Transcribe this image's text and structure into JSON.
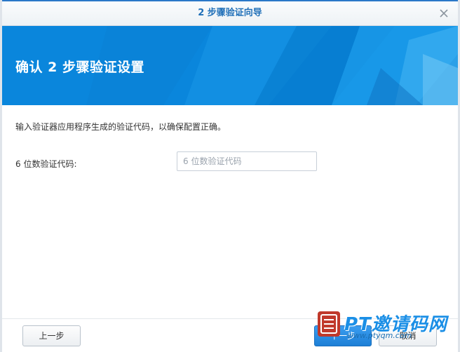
{
  "window": {
    "title": "2 步骤验证向导",
    "close_icon": "close-icon"
  },
  "banner": {
    "title": "确认 2 步骤验证设置",
    "accent": "#0a86dc"
  },
  "content": {
    "instruction": "输入验证器应用程序生成的验证代码，以确保配置正确。",
    "code_field": {
      "label": "6 位数验证代码:",
      "value": "",
      "placeholder": "6 位数验证代码"
    }
  },
  "footer": {
    "prev_label": "上一步",
    "next_label": "下一步",
    "cancel_label": "取消"
  },
  "watermark": {
    "main": "PT邀请码网",
    "sub": "www.ptyqm.com"
  }
}
